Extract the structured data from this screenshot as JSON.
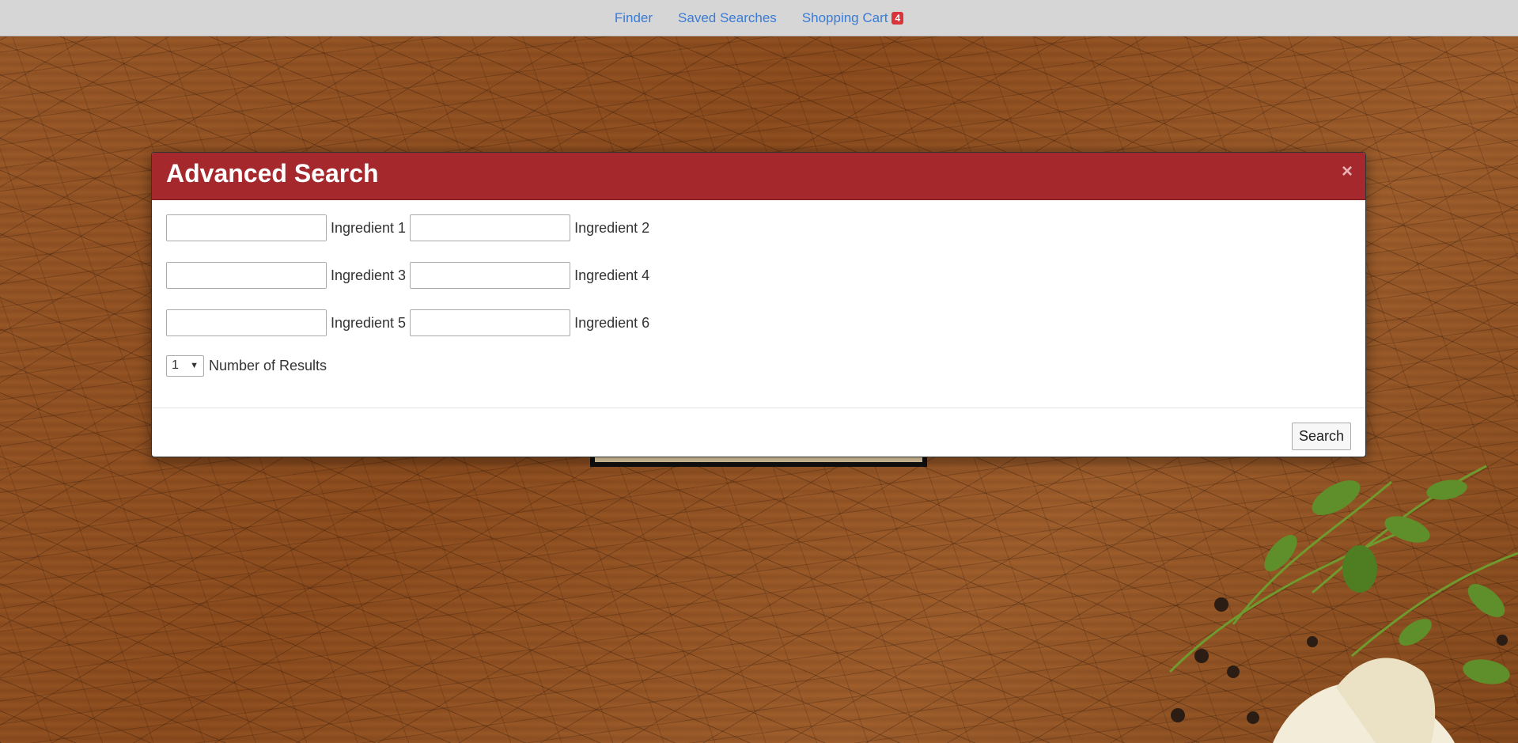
{
  "nav": {
    "finder": "Finder",
    "saved_searches": "Saved Searches",
    "shopping_cart": "Shopping Cart",
    "cart_count": "4"
  },
  "modal": {
    "title": "Advanced Search",
    "close": "×",
    "fields": [
      {
        "label": "Ingredient 1",
        "value": ""
      },
      {
        "label": "Ingredient 2",
        "value": ""
      },
      {
        "label": "Ingredient 3",
        "value": ""
      },
      {
        "label": "Ingredient 4",
        "value": ""
      },
      {
        "label": "Ingredient 5",
        "value": ""
      },
      {
        "label": "Ingredient 6",
        "value": ""
      }
    ],
    "results": {
      "selected": "1",
      "label": "Number of Results"
    },
    "search_button": "Search"
  },
  "colors": {
    "header": "#a4282c",
    "link": "#3a7bd5",
    "badge": "#d9343a"
  }
}
